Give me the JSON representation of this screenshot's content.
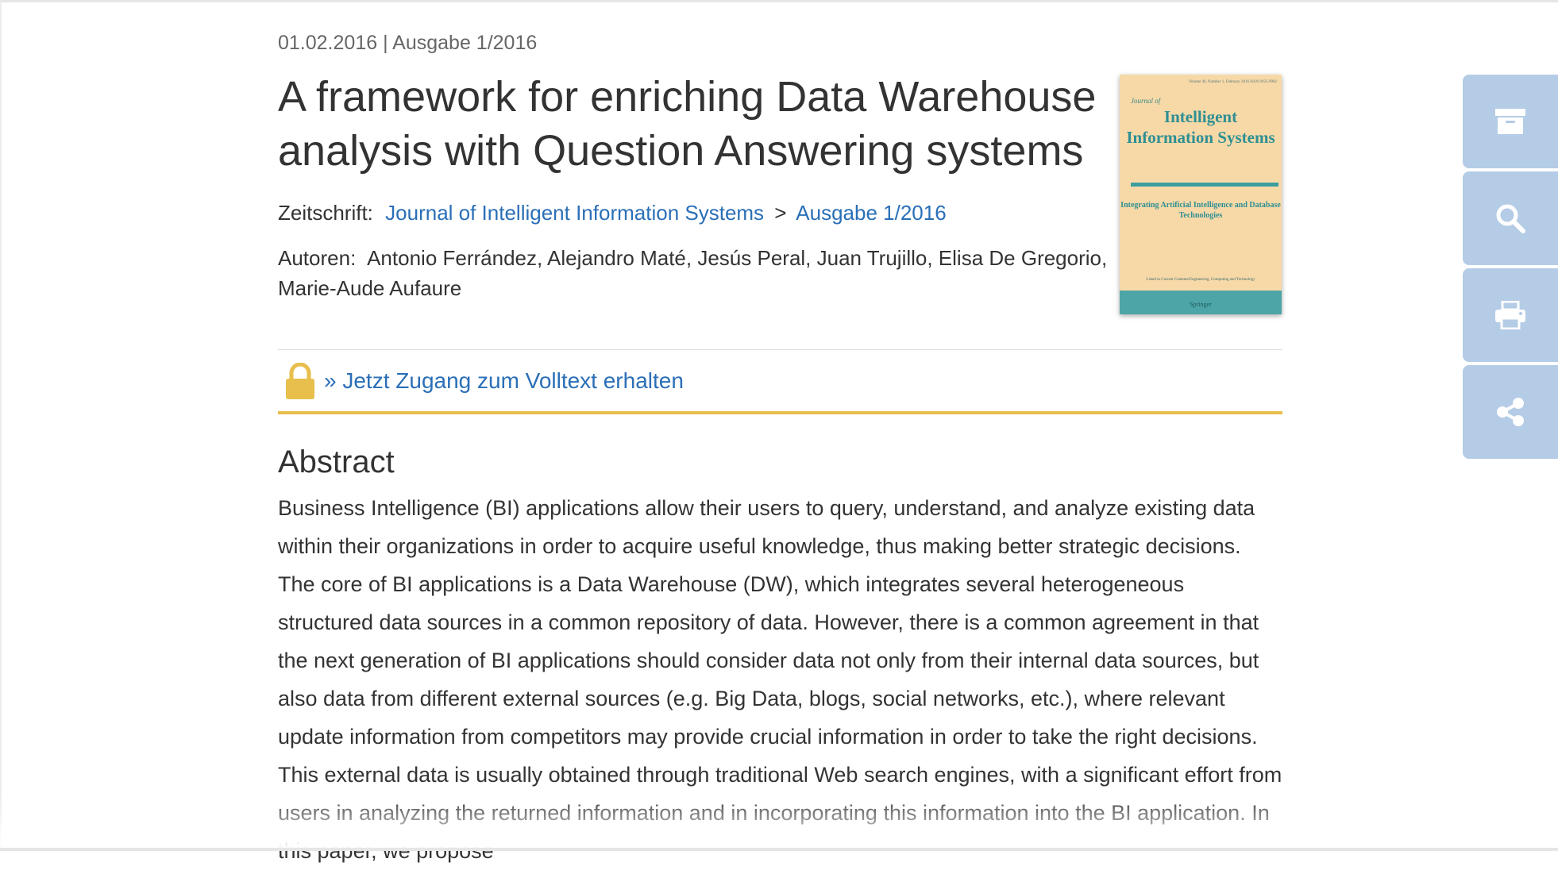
{
  "article": {
    "date": "01.02.2016",
    "issue_separator": "|",
    "issue": "Ausgabe 1/2016",
    "title": "A framework for enriching Data Warehouse analysis with Question Answering systems"
  },
  "journal": {
    "label": "Zeitschrift:",
    "name": "Journal of Intelligent Information Systems",
    "separator": ">",
    "issue_link": "Ausgabe 1/2016"
  },
  "authors": {
    "label": "Autoren:",
    "names": "Antonio Ferrández, Alejandro Maté, Jesús Peral, Juan Trujillo, Elisa De Gregorio, Marie-Aude Aufaure"
  },
  "cover": {
    "top_text": "Volume 46, Number 1, February 2016 ISSN 0925-9902",
    "journal_of": "Journal of",
    "title": "Intelligent Information Systems",
    "subtitle": "Integrating Artificial Intelligence and Database Technologies",
    "indexed": "Listed in Current Contents/Engineering, Computing and Technology",
    "publisher": "Springer"
  },
  "access": {
    "link_text": "» Jetzt Zugang zum Volltext erhalten",
    "lock_color": "#e8be4c"
  },
  "abstract": {
    "heading": "Abstract",
    "text": "Business Intelligence (BI) applications allow their users to query, understand, and analyze existing data within their organizations in order to acquire useful knowledge, thus making better strategic decisions. The core of BI applications is a Data Warehouse (DW), which integrates several heterogeneous structured data sources in a common repository of data. However, there is a common agreement in that the next generation of BI applications should consider data not only from their internal data sources, but also data from different external sources (e.g. Big Data, blogs, social networks, etc.), where relevant update information from competitors may provide crucial information in order to take the right decisions. This external data is usually obtained through traditional Web search engines, with a significant effort from users in analyzing the returned information and in incorporating this information into the BI application. In this paper, we propose"
  },
  "toolbar": {
    "buttons": [
      {
        "icon": "archive-icon"
      },
      {
        "icon": "search-icon"
      },
      {
        "icon": "print-icon"
      },
      {
        "icon": "share-icon"
      }
    ],
    "color": "#b4cce6"
  },
  "colors": {
    "link": "#2a6fb7",
    "text": "#333333",
    "accent": "#e8be4c"
  }
}
